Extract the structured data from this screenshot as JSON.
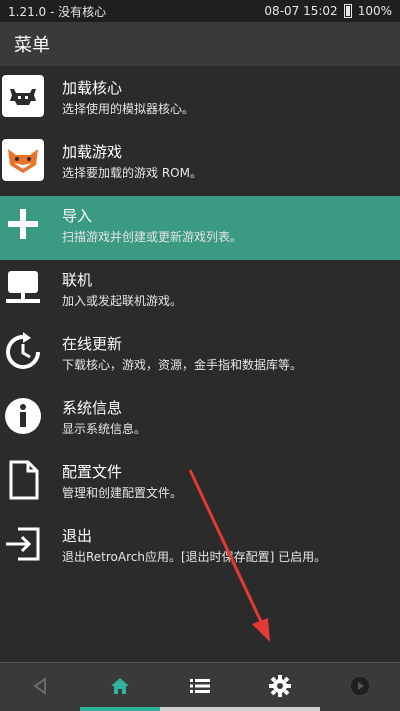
{
  "statusbar": {
    "left_text": "1.21.0 - 没有核心",
    "datetime": "08-07 15:02",
    "battery": "100%"
  },
  "header": {
    "title": "菜单"
  },
  "menu": {
    "items": [
      {
        "title": "加载核心",
        "subtitle": "选择使用的模拟器核心。",
        "icon": "retroarch-core-icon"
      },
      {
        "title": "加载游戏",
        "subtitle": "选择要加载的游戏 ROM。",
        "icon": "fox-game-icon"
      },
      {
        "title": "导入",
        "subtitle": "扫描游戏并创建或更新游戏列表。",
        "icon": "plus-icon"
      },
      {
        "title": "联机",
        "subtitle": "加入或发起联机游戏。",
        "icon": "netplay-icon"
      },
      {
        "title": "在线更新",
        "subtitle": "下载核心，游戏，资源，金手指和数据库等。",
        "icon": "update-icon"
      },
      {
        "title": "系统信息",
        "subtitle": "显示系统信息。",
        "icon": "info-icon"
      },
      {
        "title": "配置文件",
        "subtitle": "管理和创建配置文件。",
        "icon": "file-icon"
      },
      {
        "title": "退出",
        "subtitle": "退出RetroArch应用。[退出时保存配置] 已启用。",
        "icon": "exit-icon"
      }
    ],
    "selected_index": 2
  },
  "bottom_nav": {
    "icons": [
      "back-icon",
      "home-icon",
      "list-icon",
      "gear-icon",
      "play-icon"
    ]
  },
  "colors": {
    "accent": "#3b9b82",
    "nav_active": "#2fb39a",
    "annotation_arrow": "#e53935"
  }
}
